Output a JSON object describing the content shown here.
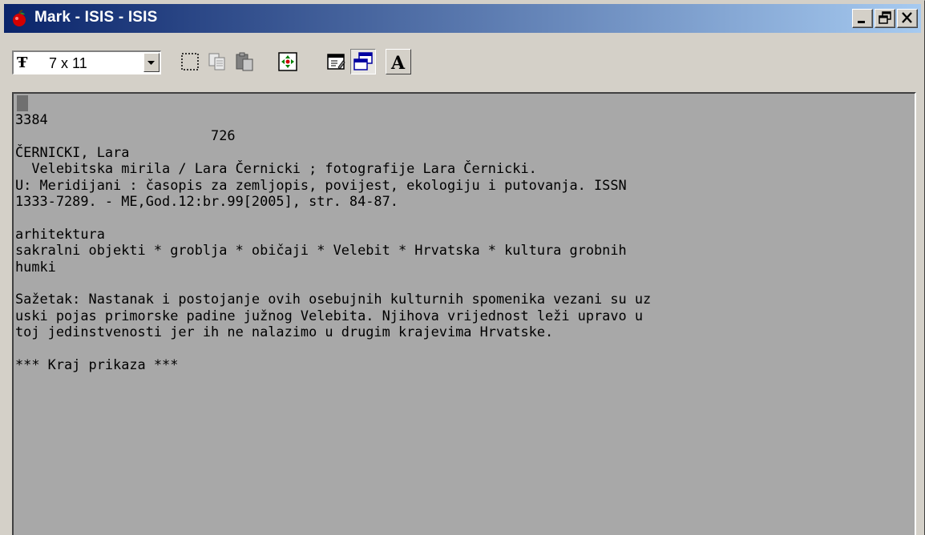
{
  "window": {
    "title": "Mark - ISIS - ISIS",
    "controls": [
      "_",
      "▫",
      "✕"
    ]
  },
  "toolbar": {
    "font_size": "7 x 11",
    "icons": [
      "font-icon",
      "select-all-icon",
      "copy-icon",
      "paste-icon",
      "fit-screen-icon",
      "properties-icon",
      "window-mode-icon",
      "font-style-icon"
    ]
  },
  "record": {
    "lines": [
      "3384",
      "                        726",
      "ČERNICKI, Lara",
      "  Velebitska mirila / Lara Černicki ; fotografije Lara Černicki.",
      "U: Meridijani : časopis za zemljopis, povijest, ekologiju i putovanja. ISSN",
      "1333-7289. - ME,God.12:br.99[2005], str. 84-87.",
      "",
      "arhitektura",
      "sakralni objekti * groblja * običaji * Velebit * Hrvatska * kultura grobnih",
      "humki",
      "",
      "Sažetak: Nastanak i postojanje ovih osebujnih kulturnih spomenika vezani su uz",
      "uski pojas primorske padine južnog Velebita. Njihova vrijednost leži upravo u",
      "toj jedinstvenosti jer ih ne nalazimo u drugim krajevima Hrvatske.",
      "",
      "*** Kraj prikaza ***"
    ]
  }
}
